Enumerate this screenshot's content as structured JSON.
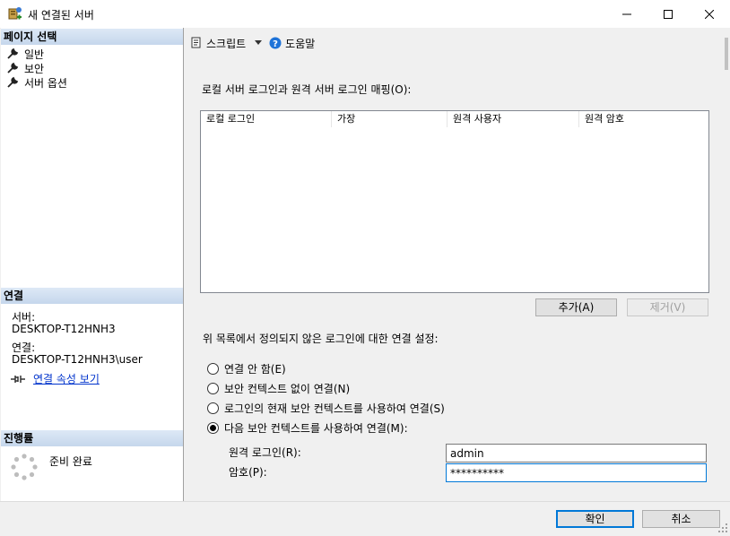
{
  "window": {
    "title": "새 연결된 서버",
    "icon": "server-icon"
  },
  "left": {
    "page_select_header": "페이지 선택",
    "pages": [
      {
        "label": "일반",
        "icon": "wrench-icon"
      },
      {
        "label": "보안",
        "icon": "wrench-icon"
      },
      {
        "label": "서버 옵션",
        "icon": "wrench-icon"
      }
    ],
    "connection_header": "연결",
    "server_label": "서버:",
    "server_value": "DESKTOP-T12HNH3",
    "connection_label": "연결:",
    "connection_value": "DESKTOP-T12HNH3\\user",
    "view_properties_link": "연결 속성 보기",
    "progress_header": "진행률",
    "progress_status": "준비 완료"
  },
  "toolbar": {
    "script_label": "스크립트",
    "help_label": "도움말"
  },
  "main": {
    "mapping_label": "로컬 서버 로그인과 원격 서버 로그인 매핑(O):",
    "columns": [
      "로컬 로그인",
      "가장",
      "원격 사용자",
      "원격 암호"
    ],
    "rows": [],
    "add_button": "추가(A)",
    "remove_button": "제거(V)",
    "settings_label": "위 목록에서 정의되지 않은 로그인에 대한 연결 설정:",
    "radio_options": [
      {
        "label": "연결 안 함(E)",
        "checked": false
      },
      {
        "label": "보안 컨텍스트 없이 연결(N)",
        "checked": false
      },
      {
        "label": "로그인의 현재 보안 컨텍스트를 사용하여 연결(S)",
        "checked": false
      },
      {
        "label": "다음 보안 컨텍스트를 사용하여 연결(M):",
        "checked": true
      }
    ],
    "remote_login_label": "원격 로그인(R):",
    "remote_login_value": "admin",
    "password_label": "암호(P):",
    "password_value": "**********"
  },
  "footer": {
    "ok_button": "확인",
    "cancel_button": "취소"
  },
  "colors": {
    "link": "#0033cc",
    "accent": "#0078d7",
    "section_header": "#c5d7ec"
  }
}
